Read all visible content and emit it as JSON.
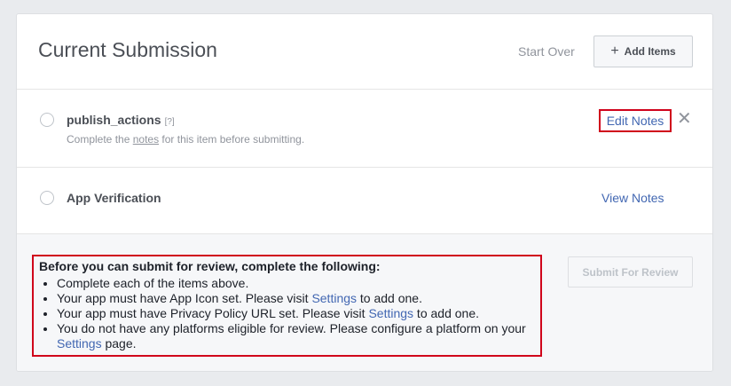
{
  "header": {
    "title": "Current Submission",
    "start_over": "Start Over",
    "add_items": "Add Items"
  },
  "items": [
    {
      "title": "publish_actions",
      "help": "[?]",
      "sub_pre": "Complete the ",
      "sub_link": "notes",
      "sub_post": " for this item before submitting.",
      "action": "Edit Notes",
      "remove": "✕"
    },
    {
      "title": "App Verification",
      "action": "View Notes"
    }
  ],
  "requirements": {
    "title": "Before you can submit for review, complete the following:",
    "items": [
      {
        "text": "Complete each of the items above."
      },
      {
        "pre": "Your app must have App Icon set. Please visit ",
        "link": "Settings",
        "post": " to add one."
      },
      {
        "pre": "Your app must have Privacy Policy URL set. Please visit ",
        "link": "Settings",
        "post": " to add one."
      },
      {
        "pre": "You do not have any platforms eligible for review. Please configure a platform on your ",
        "link": "Settings",
        "post": " page."
      }
    ]
  },
  "submit": {
    "label": "Submit For Review",
    "disabled": true
  },
  "colors": {
    "link": "#4267b2",
    "highlight": "#d0021b",
    "muted": "#90949c"
  }
}
